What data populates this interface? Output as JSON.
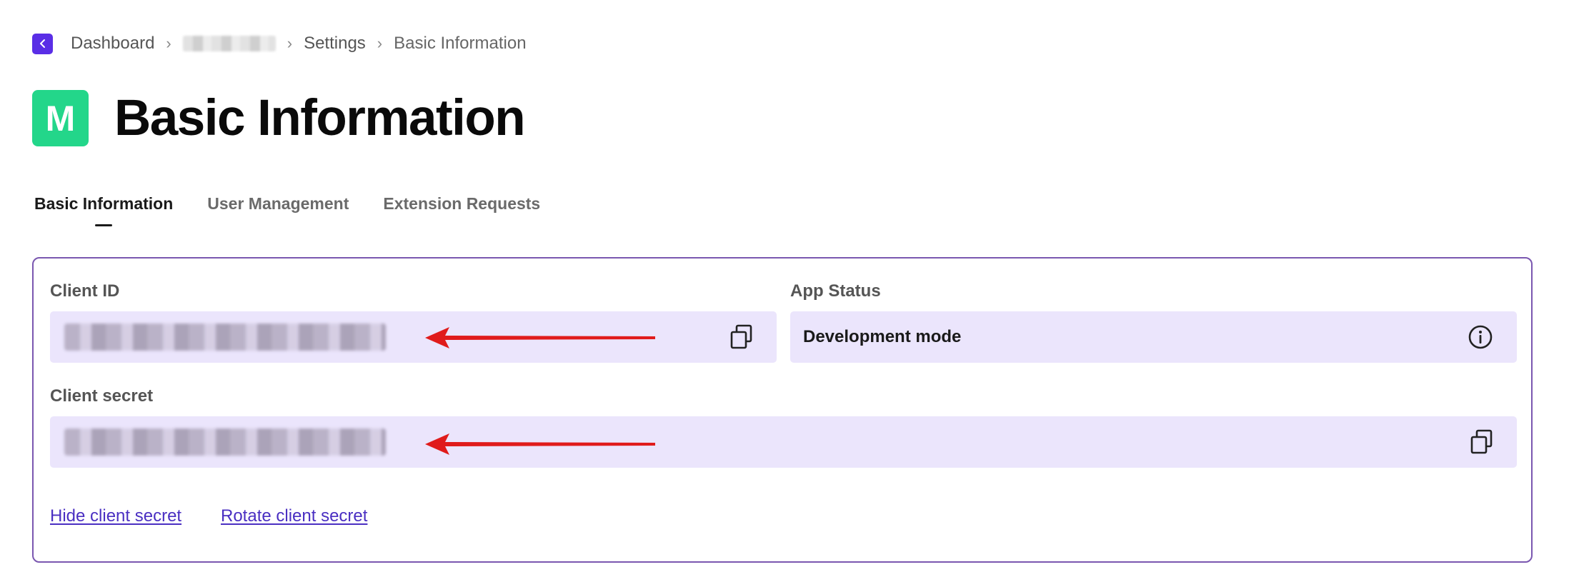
{
  "breadcrumb": {
    "items": [
      "Dashboard",
      "Settings",
      "Basic Information"
    ],
    "back_color": "#5a2ee6"
  },
  "header": {
    "app_initial": "M",
    "app_icon_color": "#23d68a",
    "title": "Basic Information"
  },
  "tabs": [
    {
      "label": "Basic Information",
      "active": true
    },
    {
      "label": "User Management",
      "active": false
    },
    {
      "label": "Extension Requests",
      "active": false
    }
  ],
  "card": {
    "client_id_label": "Client ID",
    "app_status_label": "App Status",
    "app_status_value": "Development mode",
    "client_secret_label": "Client secret",
    "hide_secret_link": "Hide client secret",
    "rotate_secret_link": "Rotate client secret"
  },
  "icons": {
    "back": "chevron-left-icon",
    "copy": "copy-icon",
    "info": "info-icon",
    "annotation_arrow": "red-arrow"
  },
  "colors": {
    "field_bg": "#ebe5fc",
    "card_border": "#7a57b0",
    "link": "#4a2fc2",
    "arrow": "#e01b1b"
  }
}
